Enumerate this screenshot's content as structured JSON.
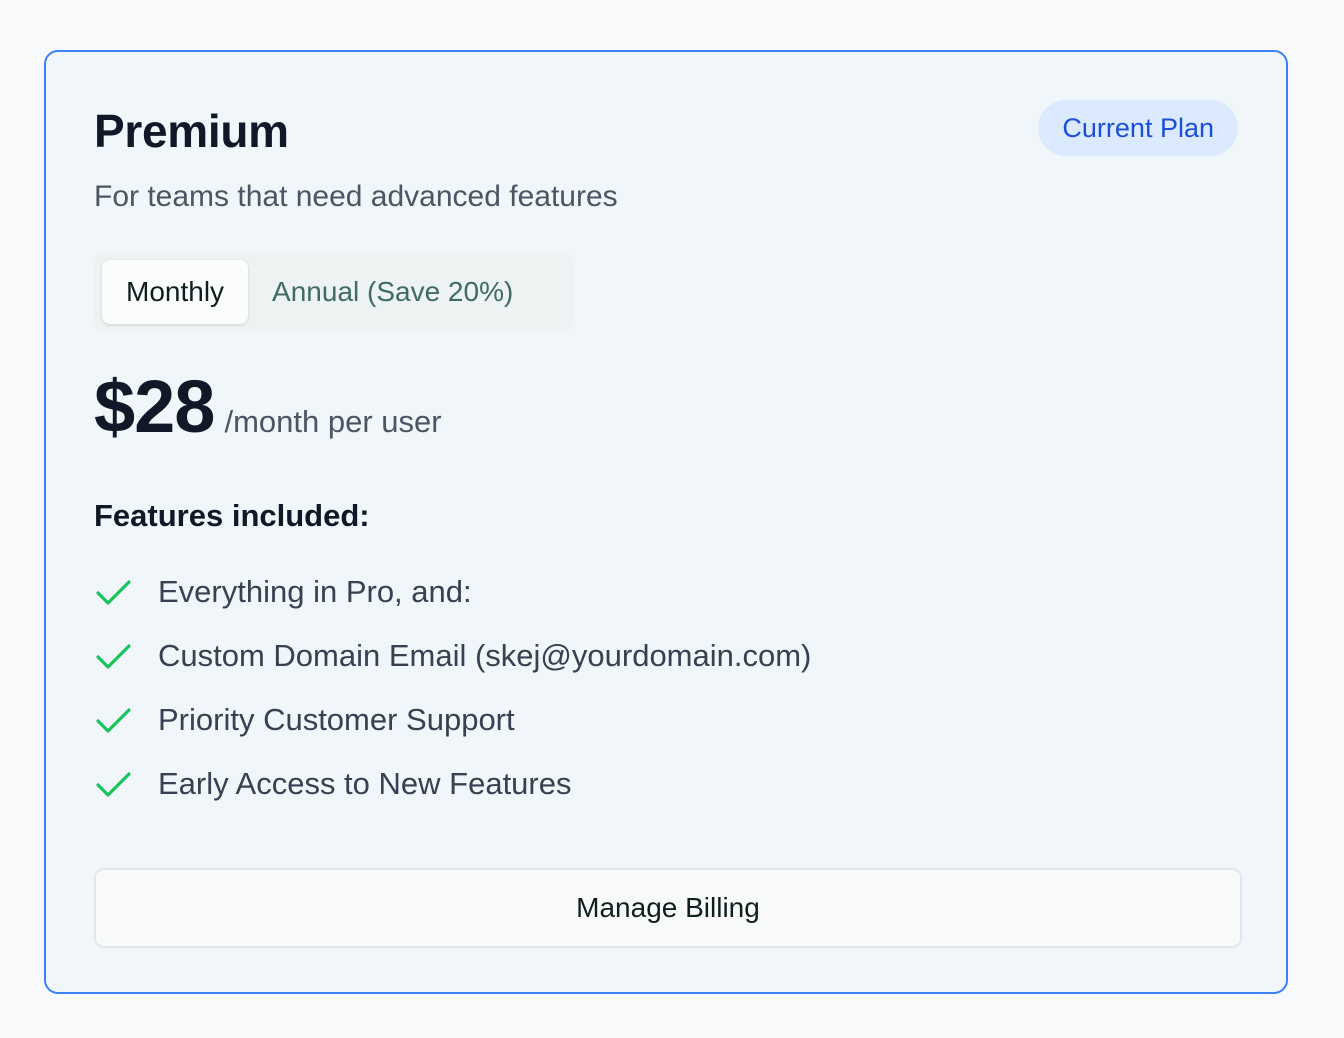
{
  "plan": {
    "name": "Premium",
    "badge": "Current Plan",
    "description": "For teams that need advanced features"
  },
  "billing_toggle": {
    "options": [
      "Monthly",
      "Annual (Save 20%)"
    ],
    "selected": "Monthly"
  },
  "pricing": {
    "amount": "$28",
    "period": "/month per user"
  },
  "features": {
    "heading": "Features included:",
    "icon": "check-icon",
    "items": [
      "Everything in Pro, and:",
      "Custom Domain Email (skej@yourdomain.com)",
      "Priority Customer Support",
      "Early Access to New Features"
    ]
  },
  "actions": {
    "manage_billing": "Manage Billing"
  },
  "colors": {
    "card_border": "#3b82f6",
    "badge_background": "#dbeafe",
    "badge_text": "#1d4ed8",
    "check": "#16c45a"
  }
}
